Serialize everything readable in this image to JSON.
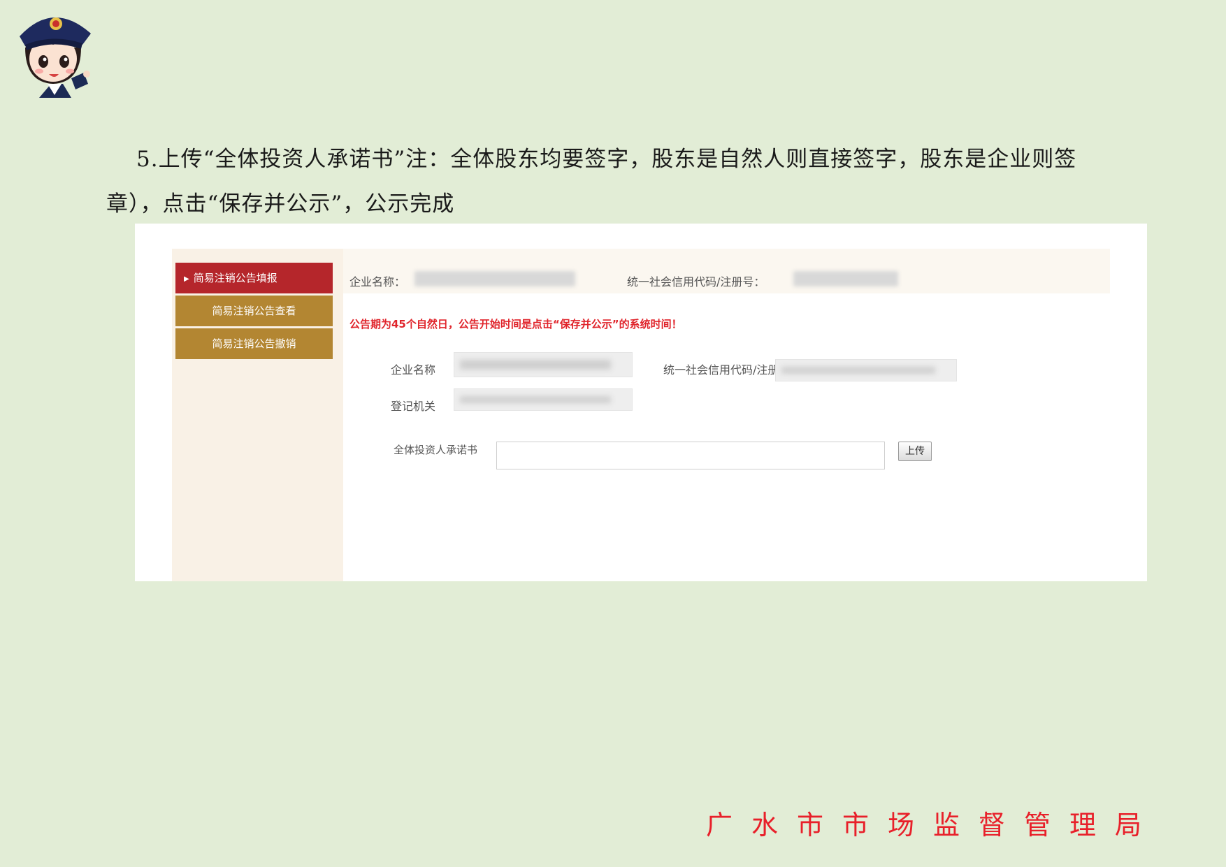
{
  "instruction": "5.上传“全体投资人承诺书”注：全体股东均要签字，股东是自然人则直接签字，股东是企业则签章），点击“保存并公示”，公示完成",
  "sidebar": {
    "items": [
      {
        "label": "简易注销公告填报"
      },
      {
        "label": "简易注销公告查看"
      },
      {
        "label": "简易注销公告撤销"
      }
    ]
  },
  "header": {
    "company_label": "企业名称：",
    "credit_label": "统一社会信用代码/注册号："
  },
  "notice": "公告期为45个自然日，公告开始时间是点击“保存并公示”的系统时间！",
  "form": {
    "company_label": "企业名称",
    "credit_label": "统一社会信用代码/注册号",
    "authority_label": "登记机关",
    "commitment_label": "全体投资人承诺书",
    "upload_label": "上传"
  },
  "footer": "广水市市场监督管理局"
}
